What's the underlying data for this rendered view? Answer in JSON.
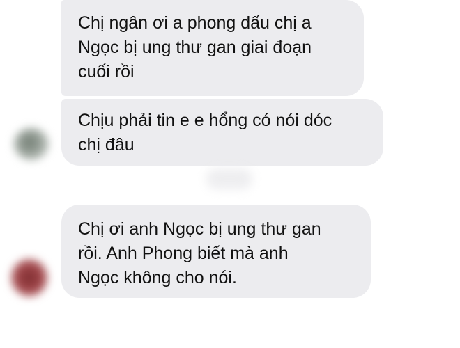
{
  "messages": [
    {
      "lines": [
        "Chị ngân ơi a phong dấu chị a",
        "Ngọc bị ung thư gan giai đoạn",
        "cuối rồi"
      ]
    },
    {
      "lines": [
        "Chịu phải tin e e hổng có nói dóc",
        "chị đâu"
      ]
    },
    {
      "lines": [
        "Chị ơi anh Ngọc bị ung thư gan",
        "rồi. Anh Phong biết mà anh",
        "Ngọc không cho nói."
      ]
    }
  ],
  "colors": {
    "bubble_background": "#ececef",
    "text": "#111111",
    "page_background": "#ffffff"
  },
  "icons": {
    "avatar_1": "blurred-avatar",
    "avatar_2": "blurred-avatar"
  }
}
